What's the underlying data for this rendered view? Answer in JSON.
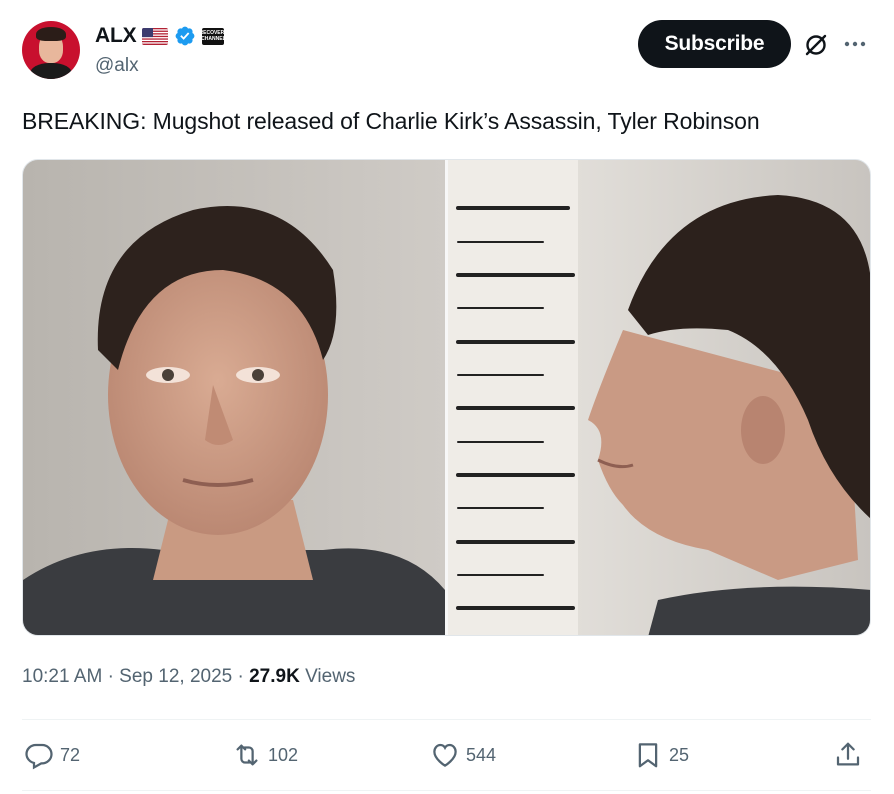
{
  "author": {
    "name": "ALX",
    "handle": "@alx",
    "badge_text": "RECOVERY CHANNEL",
    "avatar_color": "#c8102e"
  },
  "header": {
    "subscribe_label": "Subscribe",
    "icons": [
      "us-flag-icon",
      "verified-icon",
      "organization-badge-icon",
      "grok-icon",
      "more-icon"
    ]
  },
  "tweet": {
    "text": "BREAKING: Mugshot released of Charlie Kirk’s Assassin, Tyler Robinson"
  },
  "media": {
    "images": [
      "mugshot-front",
      "mugshot-profile"
    ]
  },
  "meta": {
    "time": "10:21 AM",
    "date": "Sep 12, 2025",
    "separator": "·",
    "views_count": "27.9K",
    "views_label": "Views"
  },
  "actions": {
    "replies": "72",
    "reposts": "102",
    "likes": "544",
    "bookmarks": "25"
  },
  "colors": {
    "text_primary": "#0f1419",
    "text_secondary": "#536471",
    "verified_blue": "#1d9bf0",
    "button_bg": "#0f1419"
  }
}
